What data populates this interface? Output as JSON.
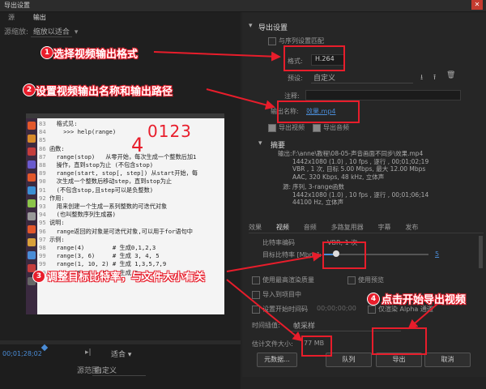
{
  "window": {
    "title": "导出设置"
  },
  "left": {
    "tabs": [
      "源",
      "输出"
    ],
    "scale_label": "源缩放:",
    "scale_value": "缩放以适合",
    "code_lines": [
      {
        "n": "83",
        "t": "  格式见:"
      },
      {
        "n": "84",
        "t": "    >>> help(range)"
      },
      {
        "n": "85",
        "t": ""
      },
      {
        "n": "86",
        "t": "函数:"
      },
      {
        "n": "87",
        "t": "  range(stop)   从零开始，每次生成一个整数后加1"
      },
      {
        "n": "88",
        "t": "  操作，直到stop为止 (不包含stop)"
      },
      {
        "n": "89",
        "t": "  range(start, stop[, step]) 从start开始，每"
      },
      {
        "n": "90",
        "t": "  次生成一个整数后移动step，直到stop为止"
      },
      {
        "n": "91",
        "t": "  (不包含stop,且step可以是负整数)"
      },
      {
        "n": "92",
        "t": "作用:"
      },
      {
        "n": "93",
        "t": "  用来创建一个生成一系列整数的可迭代对象"
      },
      {
        "n": "94",
        "t": "  (也叫整数序列生成器)"
      },
      {
        "n": "95",
        "t": "说明:"
      },
      {
        "n": "96",
        "t": "  range返回的对象是可迭代对象,可以用于for语句中"
      },
      {
        "n": "97",
        "t": "示例:"
      },
      {
        "n": "98",
        "t": "  range(4)        # 生成0,1,2,3"
      },
      {
        "n": "99",
        "t": "  range(3, 6)     # 生成 3, 4, 5"
      },
      {
        "n": "99",
        "t": "  range(1, 10, 2) # 生成 1,3,5,7,9"
      },
      {
        "n": "99",
        "t": "  range(5, 0, -2) # 生成 5,"
      }
    ],
    "handwriting": "0123",
    "handwriting2": "4",
    "timecode": "00;01;28;02",
    "fit_value": "适合",
    "range_label": "源范围:",
    "range_value": "自定义"
  },
  "right": {
    "section_title": "导出设置",
    "match_sequence": "与序列设置匹配",
    "format_label": "格式:",
    "format_value": "H.264",
    "preset_label": "预设:",
    "preset_value": "自定义",
    "comments_label": "注释:",
    "output_name_label": "输出名称:",
    "output_name_value": "效果.mp4",
    "export_video": "导出视频",
    "export_audio": "导出音频",
    "summary_title": "摘要",
    "summary_output_label": "输出:",
    "summary_output": [
      "F:\\anne\\教程\\08-05-声音画面不同步\\效果.mp4",
      "1442x1080 (1.0) , 10 fps , 逐行 , 00;01;02;19",
      "VBR , 1 次, 目标 5.00 Mbps, 最大 12.00 Mbps",
      "AAC, 320 Kbps, 48 kHz, 立体声"
    ],
    "summary_source_label": "源:",
    "summary_source": [
      "序列, 3-range函数",
      "1442x1080 (1.0) , 10 fps , 逐行 , 00;01;06;14",
      "44100 Hz, 立体声"
    ],
    "tabs": [
      "效果",
      "视频",
      "音频",
      "多路复用器",
      "字幕",
      "发布"
    ],
    "bitrate_encoding_label": "比特率编码",
    "bitrate_encoding_value": "VBR, 1 次",
    "target_bitrate_label": "目标比特率 [Mbps]:",
    "target_bitrate_value": "5",
    "target_bitrate_fraction": 0.12,
    "max_render_quality": "使用最高渲染质量",
    "use_preview": "使用预览",
    "import_project": "导入到项目中",
    "set_start_timecode": "设置开始时间码",
    "start_timecode": "00;00;00;00",
    "render_alpha": "仅渲染 Alpha 通道",
    "interp_label": "时间插值:",
    "interp_value": "帧采样",
    "est_size_label": "估计文件大小:",
    "est_size_value": "77 MB",
    "metadata_button": "元数据...",
    "queue_button": "队列",
    "export_button": "导出",
    "cancel_button": "取消"
  },
  "annotations": [
    {
      "num": "1",
      "text": "选择视频输出格式"
    },
    {
      "num": "2",
      "text": "设置视频输出名称和输出路径"
    },
    {
      "num": "3",
      "text": "调整目标比特率，与文件大小有关"
    },
    {
      "num": "4",
      "text": "点击开始导出视频"
    }
  ],
  "colors": {
    "accent_blue": "#4a8cd6",
    "annotation_red": "#e81d2b"
  }
}
